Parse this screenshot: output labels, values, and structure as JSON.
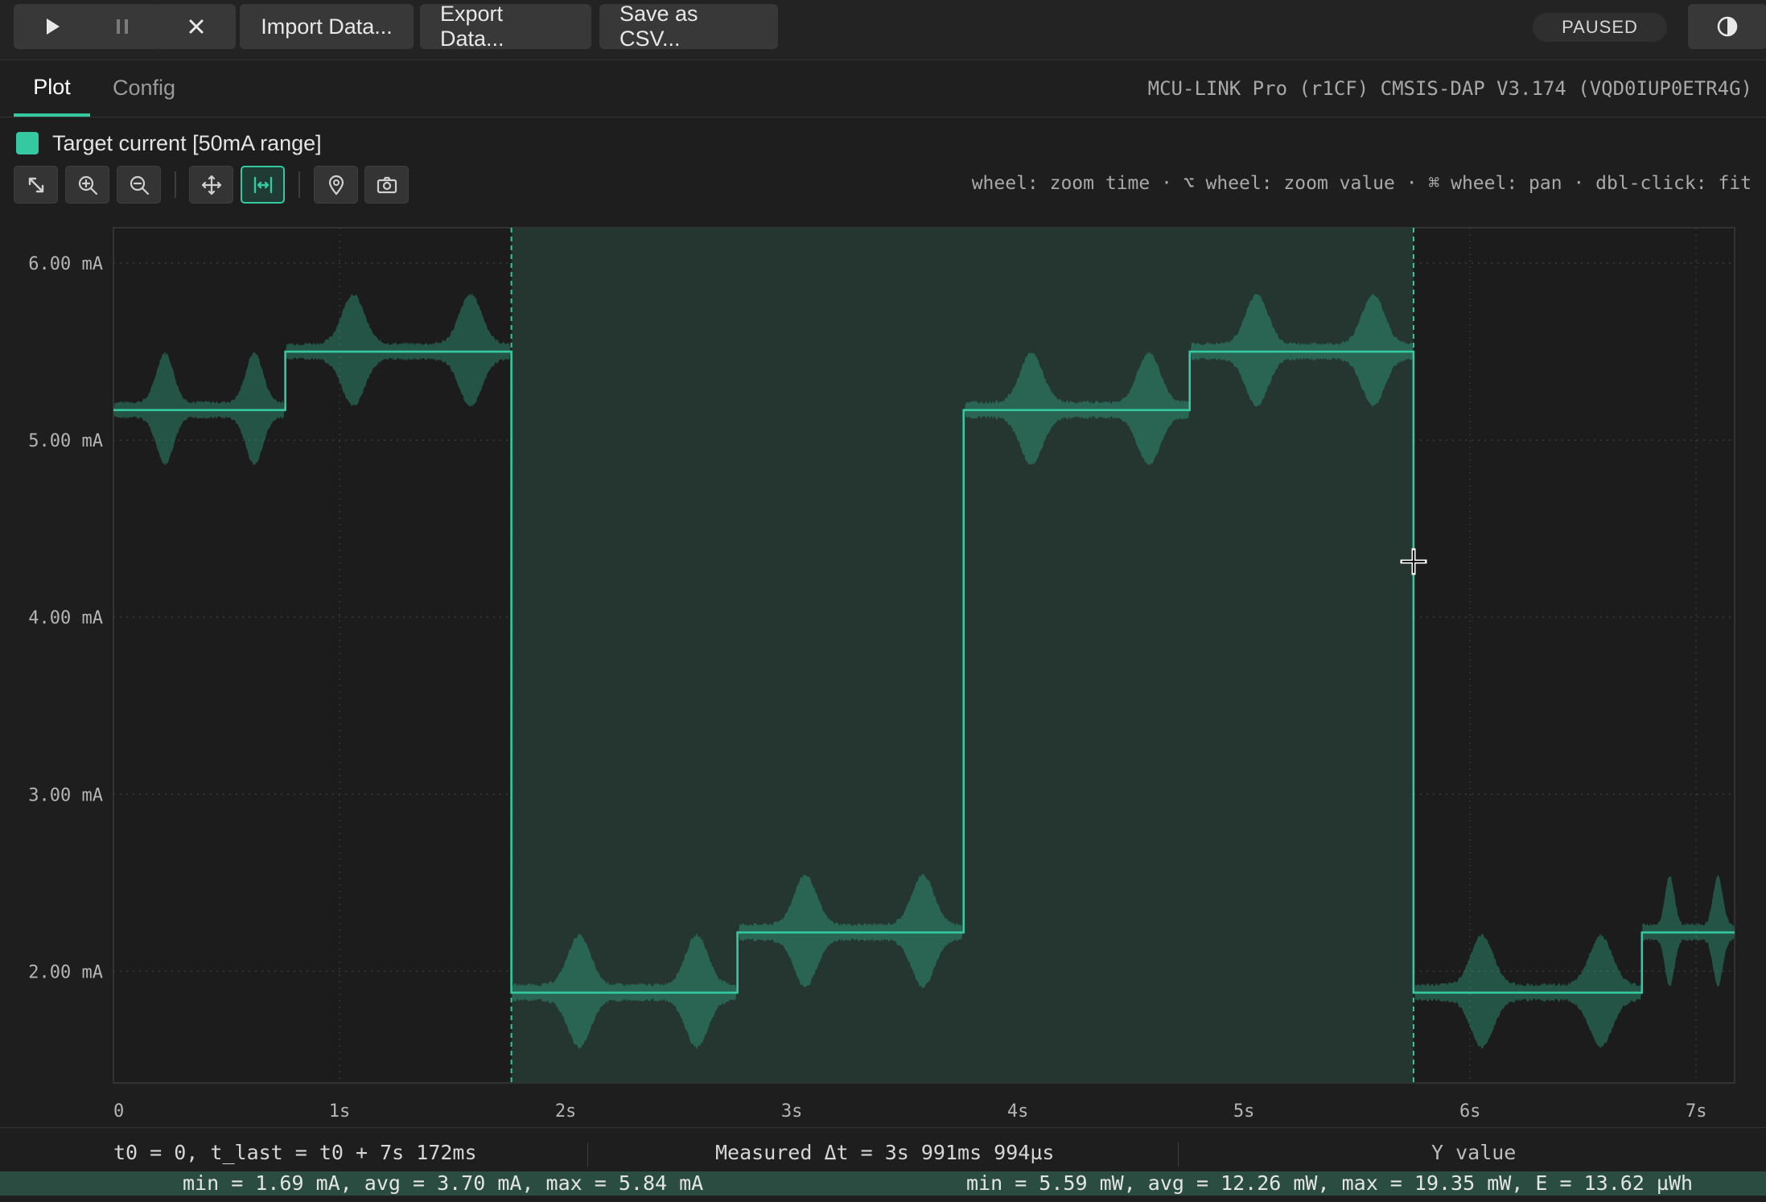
{
  "toolbar": {
    "import_label": "Import Data...",
    "export_label": "Export Data...",
    "save_csv_label": "Save as CSV...",
    "status": "PAUSED"
  },
  "tabs": {
    "plot": "Plot",
    "config": "Config"
  },
  "device": "MCU-LINK Pro (r1CF) CMSIS-DAP V3.174 (VQD0IUP0ETR4G)",
  "legend": {
    "label": "Target current [50mA range]",
    "color": "#34c9a0"
  },
  "hints": "wheel: zoom time · ⌥ wheel: zoom value · ⌘ wheel: pan · dbl-click: fit",
  "plot_tools": [
    "fit-icon",
    "zoom-in-icon",
    "zoom-out-icon",
    "pan-icon",
    "measure-icon",
    "marker-icon",
    "camera-icon"
  ],
  "chart_data": {
    "type": "line",
    "y_tick_labels": [
      "6.00 mA",
      "5.00 mA",
      "4.00 mA",
      "3.00 mA",
      "2.00 mA"
    ],
    "x_tick_labels": [
      "0",
      "1s",
      "2s",
      "3s",
      "4s",
      "5s",
      "6s",
      "7s"
    ],
    "xlim": [
      0,
      7.17
    ],
    "ylim": [
      1.37,
      6.2
    ],
    "selection": [
      1.76,
      5.75
    ],
    "series": [
      {
        "color": "#34c9a0",
        "step_starts": [
          0,
          0.76,
          1.76,
          2.76,
          3.76,
          4.76,
          5.75,
          6.76
        ],
        "step_values": [
          5.17,
          5.5,
          1.88,
          2.22,
          5.17,
          5.5,
          1.88,
          2.22
        ]
      }
    ]
  },
  "footer": {
    "time_range": "t0 = 0, t_last = t0 + 7s 172ms",
    "measured": "Measured Δt = 3s 991ms 994µs",
    "y_value": "Y value",
    "current_stats": "min = 1.69 mA, avg = 3.70 mA, max = 5.84 mA",
    "power_stats": "min = 5.59 mW, avg = 12.26 mW, max = 19.35 mW, E = 13.62 µWh"
  }
}
